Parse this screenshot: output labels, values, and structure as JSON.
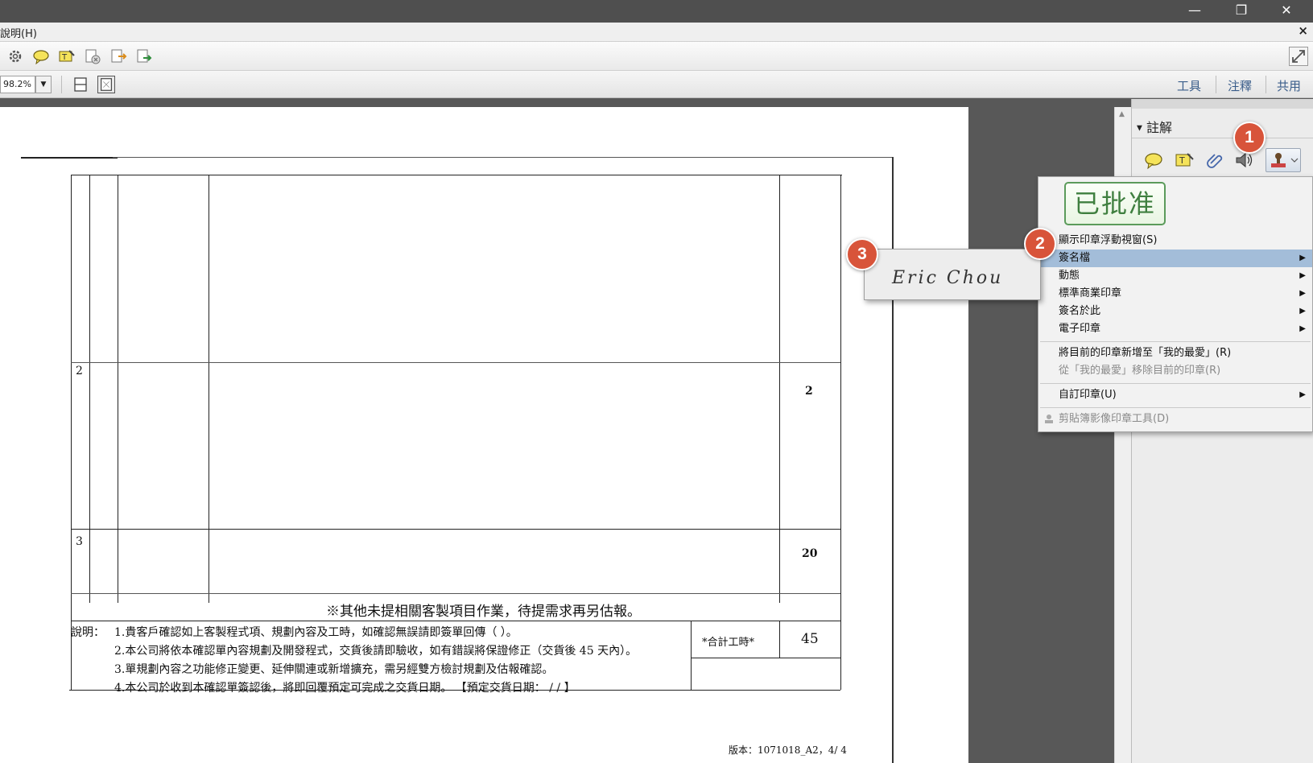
{
  "window": {
    "minimize_glyph": "—",
    "restore_glyph": "❐",
    "close_glyph": "✕"
  },
  "menubar": {
    "help_label": "說明(H)",
    "close_doc_glyph": "×"
  },
  "toolbar1": {
    "icons": [
      "gear-icon",
      "comment-bubble-icon",
      "highlight-text-icon",
      "delete-page-icon",
      "export-doc-icon",
      "export-arrow-icon"
    ]
  },
  "toolbar2": {
    "zoom_value": "98.2%",
    "zoom_drop_glyph": "▼",
    "tasks": [
      "工具",
      "注釋",
      "共用"
    ]
  },
  "right_pane": {
    "title": "註解",
    "collapse_glyph": "▼"
  },
  "stamp_menu": {
    "approved_stamp_text": "已批准",
    "items": {
      "show_palette": "顯示印章浮動視窗(S)",
      "signature": "簽名檔",
      "dynamic": "動態",
      "standard_business": "標準商業印章",
      "sign_here": "簽名於此",
      "electronic": "電子印章",
      "add_favorite": "將目前的印章新增至「我的最愛」(R)",
      "remove_favorite": "從「我的最愛」移除目前的印章(R)",
      "custom": "自訂印章(U)",
      "clipboard_tool": "剪貼簿影像印章工具(D)"
    },
    "submenu_glyph": "▶"
  },
  "signature_submenu": {
    "signature_text": "Eric Chou"
  },
  "badges": [
    "1",
    "2",
    "3"
  ],
  "document": {
    "row2_label": "2",
    "row2_hours": "2",
    "row3_label": "3",
    "row3_hours": "20",
    "note_line": "※其他未提相關客製項目作業，待提需求再另估報。",
    "notes_label": "說明：",
    "note_1": "1.貴客戶確認如上客製程式項、規劃內容及工時，如確認無誤請即簽單回傳（                    ）。",
    "note_2": "2.本公司將依本確認單內容規劃及開發程式，交貨後請即驗收，如有錯誤將保證修正（交貨後 45 天內）。",
    "note_3": "3.單規劃內容之功能修正變更、延伸關連或新增擴充，需另經雙方檢討規劃及估報確認。",
    "note_4": "4.本公司於收到本確認單簽認後，將即回覆預定可完成之交貨日期。   【預定交貨日期：    /    /     】",
    "total_label": "*合計工時*",
    "total_value": "45",
    "version": "版本：1071018_A2，4/ 4"
  },
  "colors": {
    "badge": "#d8543a",
    "menu_highlight": "#a3bdd9",
    "approved_stamp": "#3f7f3f"
  }
}
